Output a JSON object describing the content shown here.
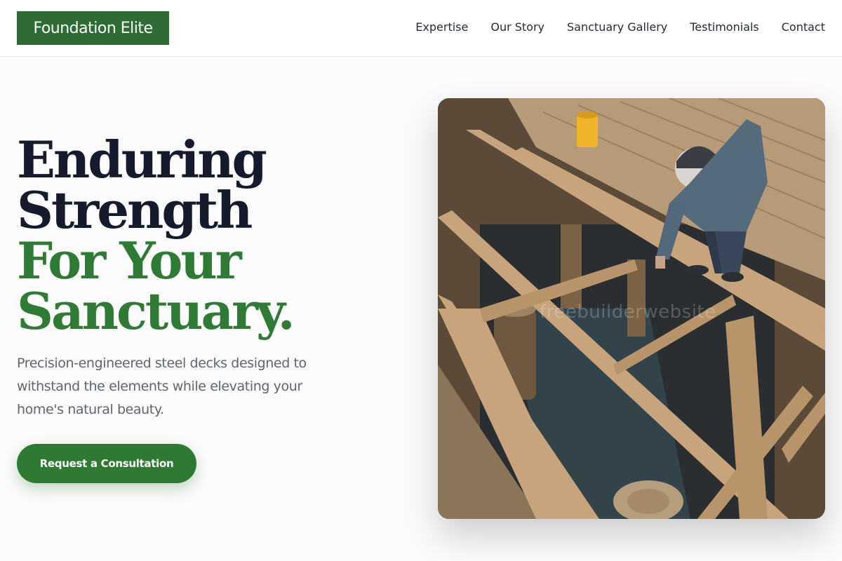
{
  "brand": {
    "logo_text": "Foundation Elite"
  },
  "nav": {
    "items": [
      "Expertise",
      "Our Story",
      "Sanctuary Gallery",
      "Testimonials",
      "Contact"
    ]
  },
  "hero": {
    "headline_line1": "Enduring",
    "headline_line2": "Strength",
    "headline_line3": "For Your",
    "headline_line4": "Sanctuary.",
    "subtext": "Precision-engineered steel decks designed to withstand the elements while elevating your home's natural beauty.",
    "cta_label": "Request a Consultation",
    "image_watermark": "freebuilderwebsite"
  },
  "colors": {
    "brand_green": "#2f6b34",
    "accent_green": "#2f7a35",
    "headline_dark": "#151a2c",
    "body_text": "#5f6470"
  }
}
